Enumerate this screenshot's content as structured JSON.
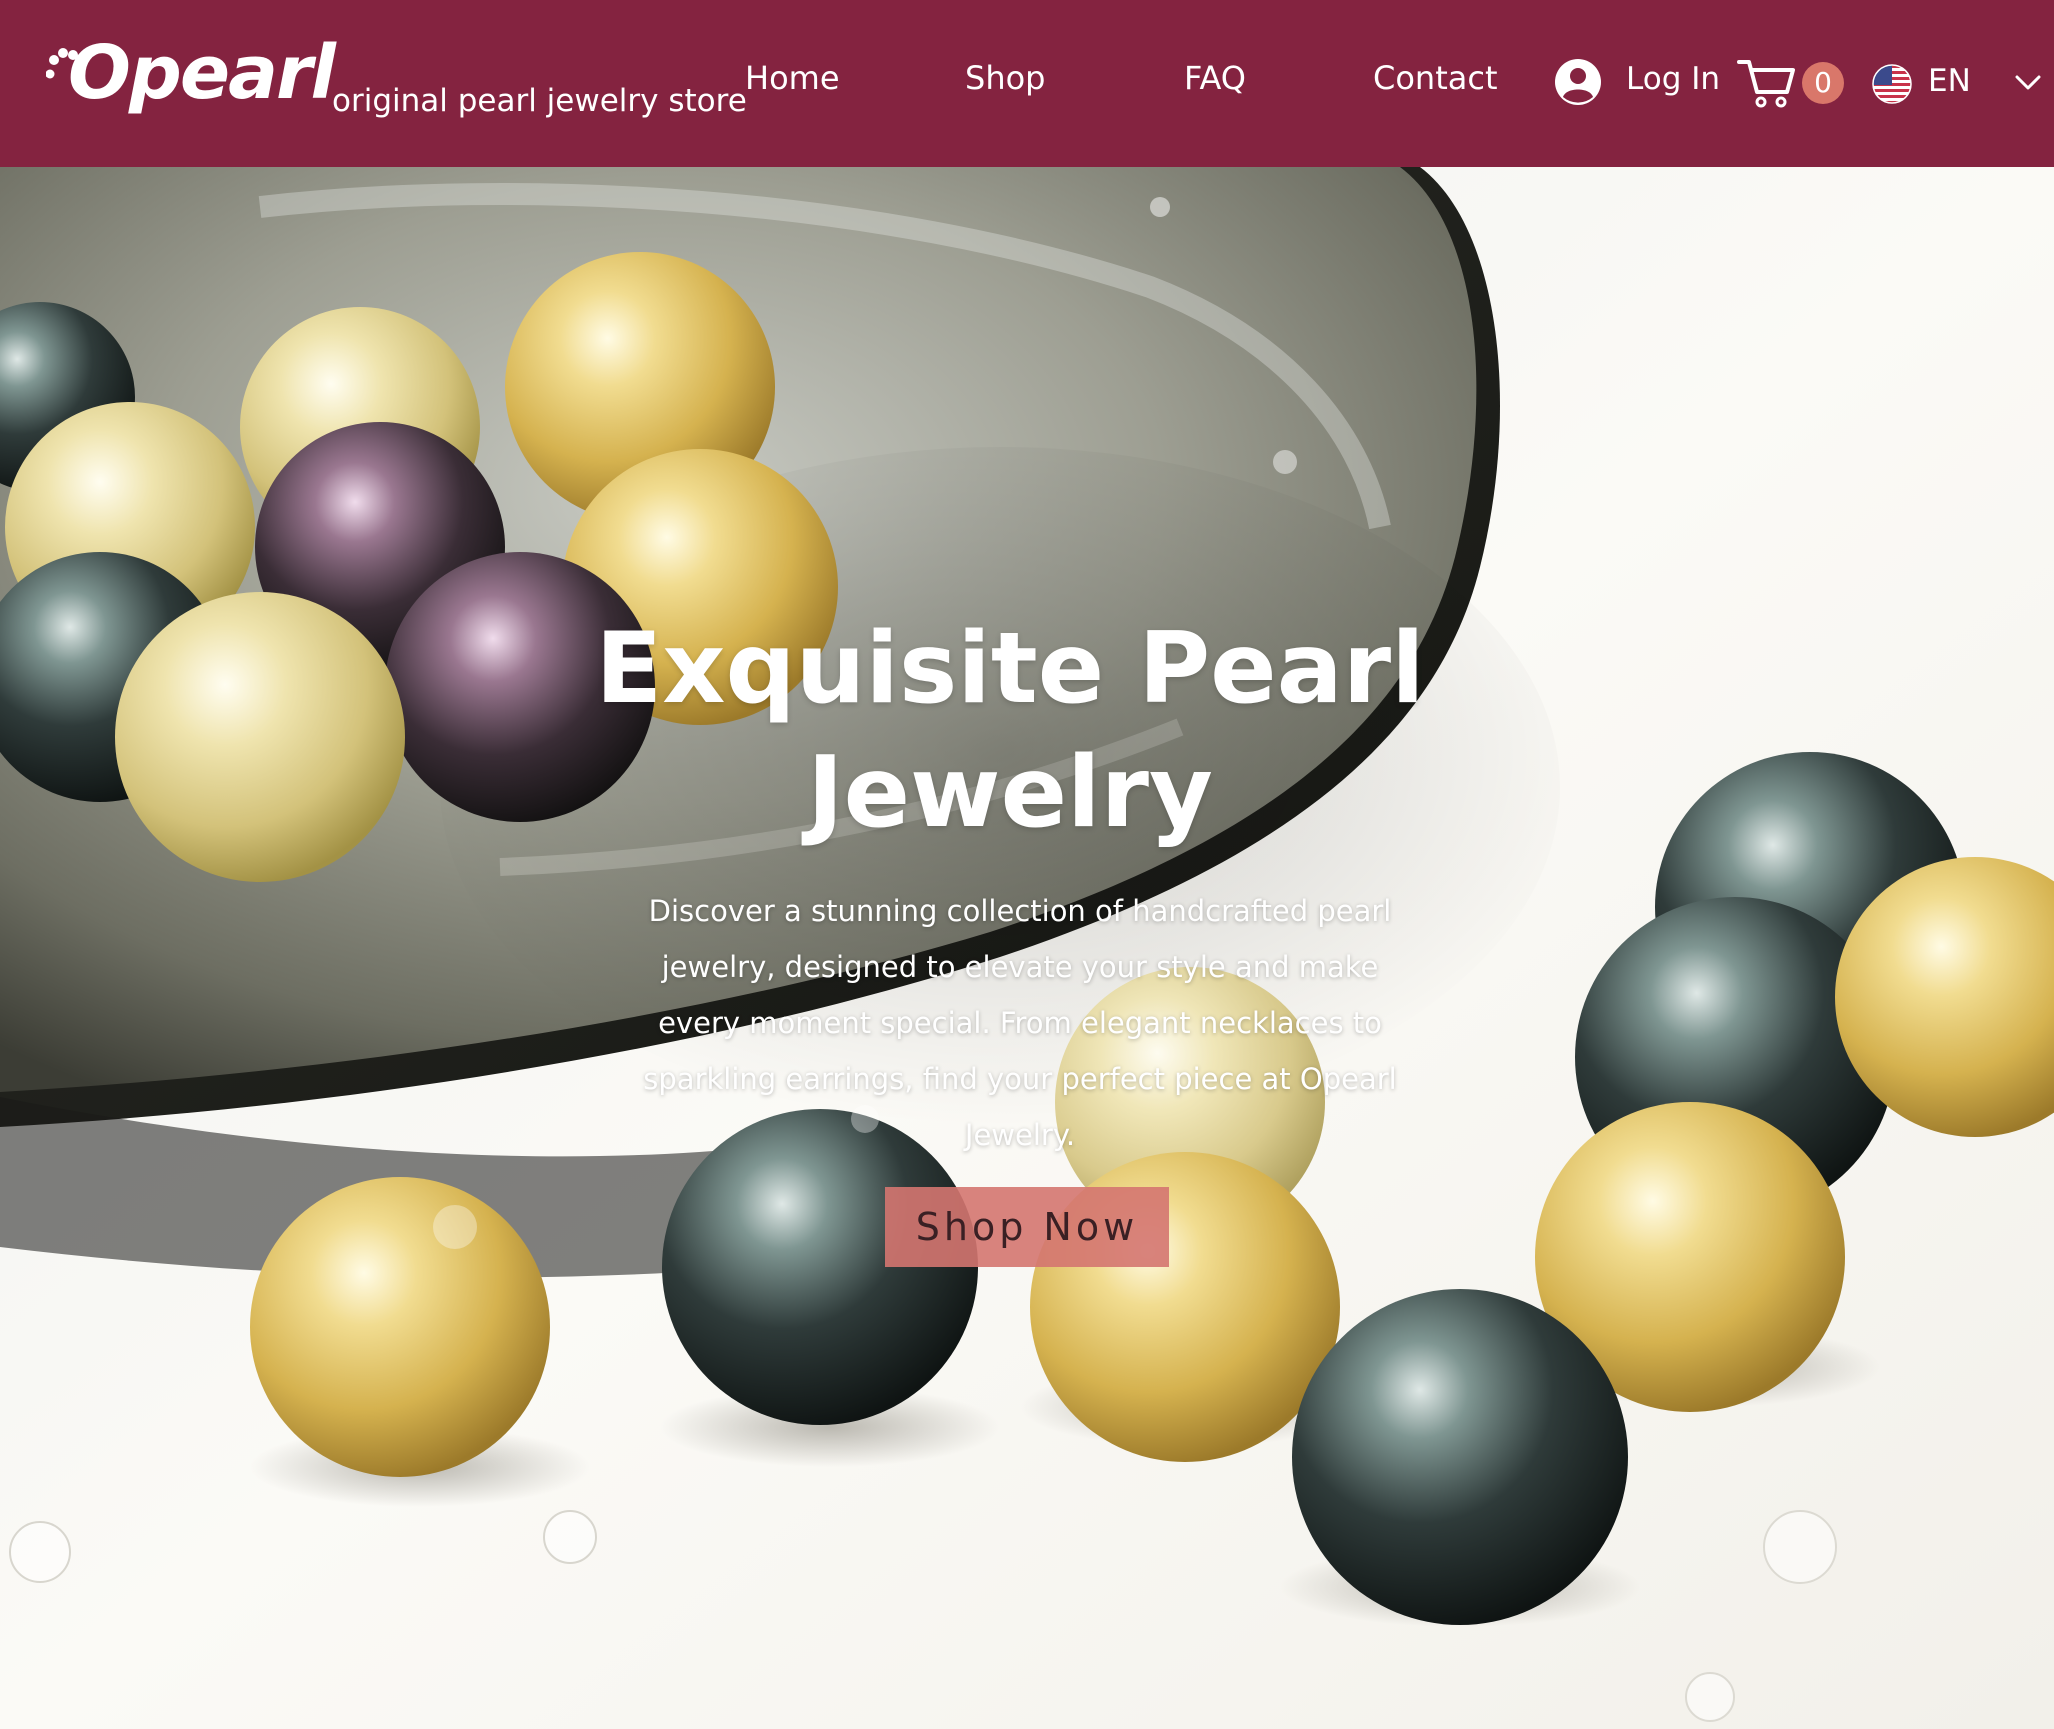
{
  "header": {
    "logo_text": "Opearl",
    "tagline": "original pearl jewelry store",
    "nav": [
      {
        "label": "Home"
      },
      {
        "label": "Shop"
      },
      {
        "label": "FAQ"
      },
      {
        "label": "Contact"
      }
    ],
    "login_label": "Log In",
    "cart_count": "0",
    "language": "EN",
    "icons": {
      "logo": "paw-icon",
      "login": "user-avatar-icon",
      "cart": "shopping-cart-icon",
      "language": "us-flag-icon",
      "dropdown": "chevron-down-icon"
    }
  },
  "hero": {
    "title": "Exquisite Pearl Jewelry",
    "description": "Discover a stunning collection of handcrafted pearl jewelry, designed to elevate your style and make every moment special. From elegant necklaces to sparkling earrings, find your perfect piece at Opearl Jewelry.",
    "cta_label": "Shop Now"
  },
  "colors": {
    "header_background": "#842340",
    "cart_badge": "#d9776a",
    "cta_background": "#d47570",
    "text": "#ffffff"
  }
}
